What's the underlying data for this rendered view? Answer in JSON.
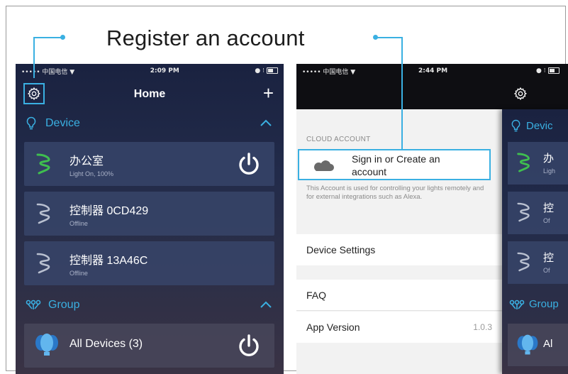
{
  "headline": "Register an account",
  "colors": {
    "accent": "#3ab0e2",
    "online_icon": "#3fbf4f",
    "offline_icon": "#b9c0d0"
  },
  "left_phone": {
    "status": {
      "carrier": "••••• 中国电信 ▼",
      "time": "2:09 PM",
      "right": "● ⁝"
    },
    "nav": {
      "title": "Home",
      "left_icon": "gear-icon",
      "right_icon": "plus-icon",
      "plus": "+"
    },
    "device_section": {
      "label": "Device"
    },
    "devices": [
      {
        "name": "办公室",
        "status": "Light On, 100%",
        "online": true
      },
      {
        "name": "控制器 0CD429",
        "status": "Offline",
        "online": false
      },
      {
        "name": "控制器 13A46C",
        "status": "Offline",
        "online": false
      }
    ],
    "group_section": {
      "label": "Group"
    },
    "groups": [
      {
        "name": "All Devices (3)"
      }
    ]
  },
  "right_phone": {
    "status": {
      "carrier": "••••• 中国电信 ▼",
      "time": "2:44 PM",
      "right": "● ⁝"
    },
    "cloud_account_title": "CLOUD ACCOUNT",
    "signin_line1": "Sign in or Create an",
    "signin_line2": "account",
    "description": "This Account is used for controlling your lights remotely and for external integrations such as Alexa.",
    "menu": [
      {
        "label": "Device Settings"
      },
      {
        "label": "FAQ"
      },
      {
        "label": "App Version",
        "value": "1.0.3"
      }
    ],
    "peek": {
      "device_label": "Devic",
      "group_label": "Group",
      "rows": [
        {
          "name": "办",
          "sub": "Ligh"
        },
        {
          "name": "控",
          "sub": "Of"
        },
        {
          "name": "控",
          "sub": "Of"
        }
      ],
      "group_row_name": "Al"
    }
  }
}
